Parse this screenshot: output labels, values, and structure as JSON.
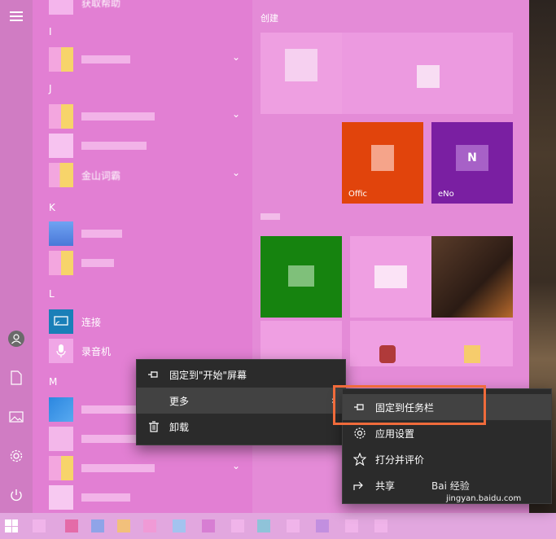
{
  "start_menu": {
    "app_list": {
      "section_letters": [
        "I",
        "J",
        "K",
        "L",
        "M"
      ],
      "apps": [
        {
          "label": "获取帮助"
        },
        {
          "label": "连接"
        },
        {
          "label": "录音机"
        },
        {
          "label": "金山词霸"
        }
      ]
    },
    "tiles": {
      "group_title": "创建",
      "office_label": "Offic",
      "onenote_label": "eNo",
      "onenote_letter": "N"
    }
  },
  "context_menu": {
    "items": [
      {
        "label": "固定到\"开始\"屏幕",
        "icon": "pin-icon"
      },
      {
        "label": "更多",
        "icon": "",
        "has_submenu": true
      },
      {
        "label": "卸载",
        "icon": "trash-icon"
      }
    ]
  },
  "submenu": {
    "items": [
      {
        "label": "固定到任务栏",
        "icon": "pin-icon",
        "highlighted": true
      },
      {
        "label": "应用设置",
        "icon": "gear-icon"
      },
      {
        "label": "打分并评价",
        "icon": "star-icon"
      },
      {
        "label": "共享",
        "icon": "share-icon"
      }
    ]
  },
  "watermark": {
    "brand": "Bai 经验",
    "url": "jingyan.baidu.com"
  },
  "colors": {
    "menu_bg": "#2b2b2b",
    "highlight": "#f06b3b",
    "office_tile": "#e1440c",
    "onenote_tile": "#7a1fa2",
    "green_tile": "#16830f"
  }
}
